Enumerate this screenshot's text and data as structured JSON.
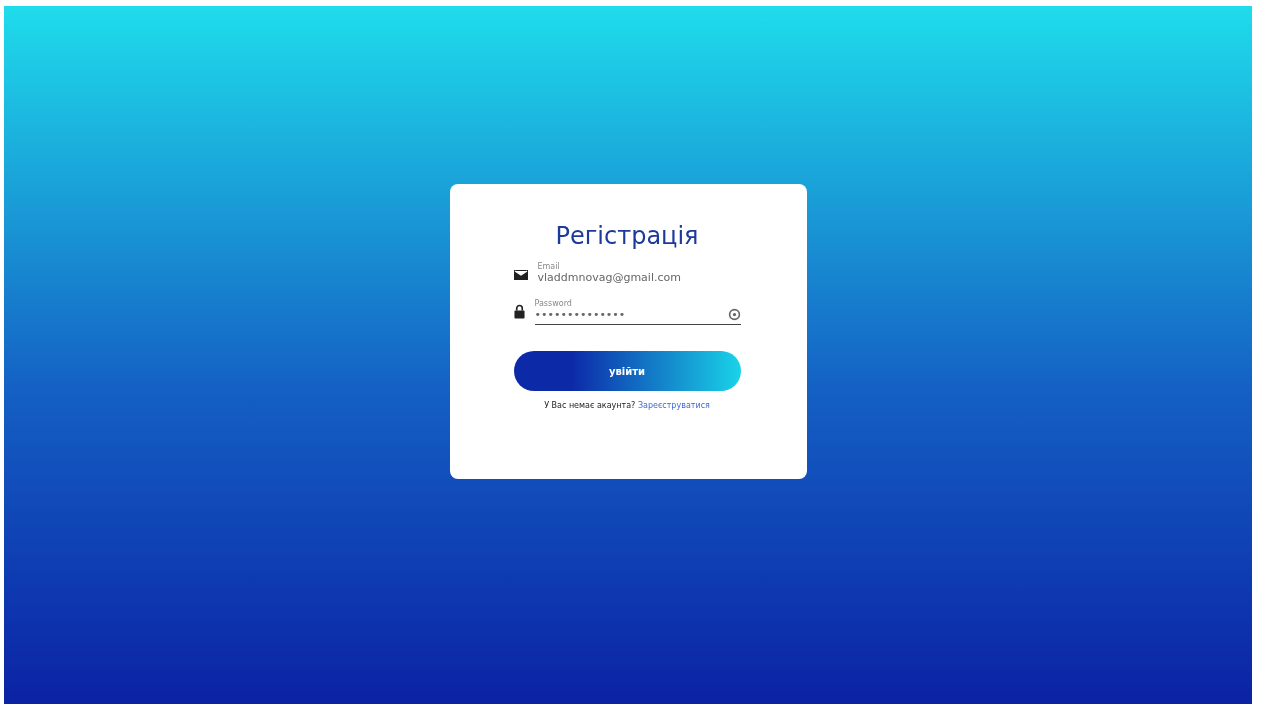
{
  "title": "Регістрація",
  "fields": [
    {
      "kind": "email",
      "label": "Email",
      "value": "vladdmnovag@gmail.com"
    },
    {
      "kind": "password",
      "label": "Password",
      "value": "••••••••••••••"
    }
  ],
  "button": "увійти",
  "footer": {
    "text": "У Вас немає акаунта?",
    "link": "Зареєструватися"
  }
}
